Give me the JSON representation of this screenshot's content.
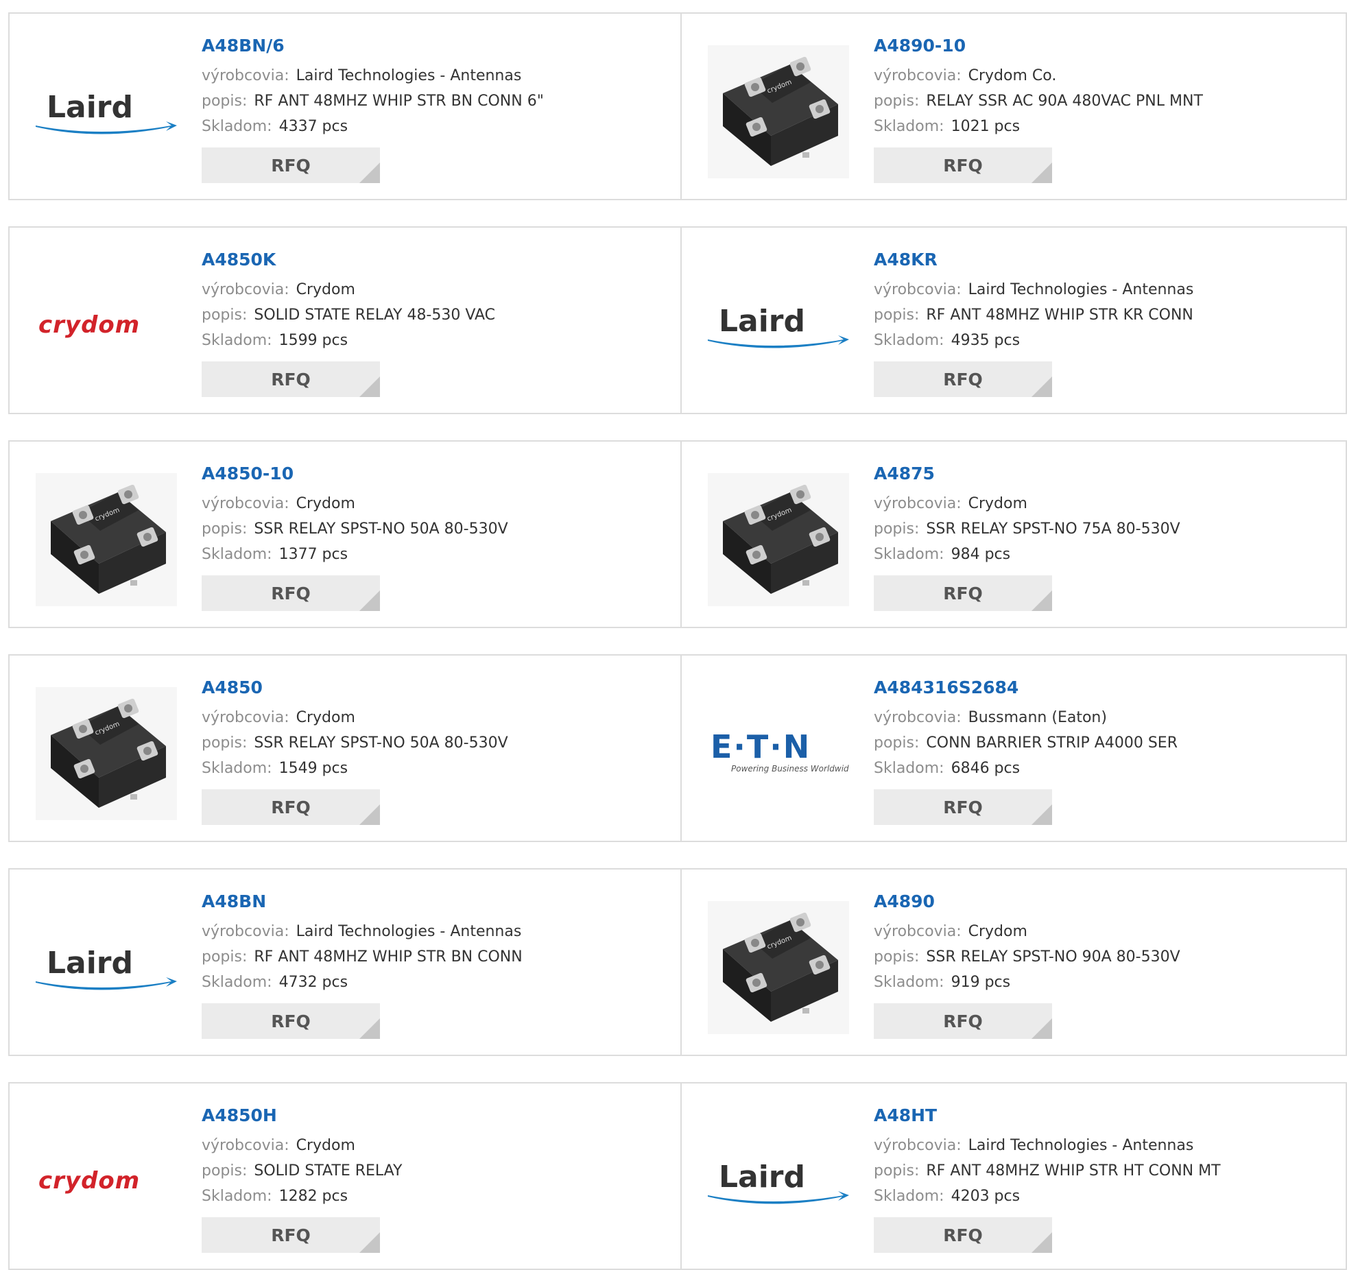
{
  "labels": {
    "manufacturer": "výrobcovia:",
    "description": "popis:",
    "stock": "Skladom:",
    "rfq": "RFQ"
  },
  "logos": {
    "laird": "Laird",
    "crydom": "crydom",
    "eaton": "E·T·N",
    "eaton_tagline": "Powering Business Worldwide",
    "relay_text": "crydom"
  },
  "colors": {
    "link": "#1a66b3",
    "laird_blue": "#1b7fc4",
    "crydom_red": "#d2232a",
    "eaton_blue": "#1b5fa8",
    "button_bg": "#ebebeb"
  },
  "products": [
    {
      "pn": "A48BN/6",
      "manufacturer": "Laird Technologies - Antennas",
      "description": "RF ANT 48MHZ WHIP STR BN CONN 6\"",
      "stock": "4337 pcs",
      "image": "laird-logo"
    },
    {
      "pn": "A4890-10",
      "manufacturer": "Crydom Co.",
      "description": "RELAY SSR AC 90A 480VAC PNL MNT",
      "stock": "1021 pcs",
      "image": "relay-photo"
    },
    {
      "pn": "A4850K",
      "manufacturer": "Crydom",
      "description": "SOLID STATE RELAY 48-530 VAC",
      "stock": "1599 pcs",
      "image": "crydom-logo"
    },
    {
      "pn": "A48KR",
      "manufacturer": "Laird Technologies - Antennas",
      "description": "RF ANT 48MHZ WHIP STR KR CONN",
      "stock": "4935 pcs",
      "image": "laird-logo"
    },
    {
      "pn": "A4850-10",
      "manufacturer": "Crydom",
      "description": "SSR RELAY SPST-NO 50A 80-530V",
      "stock": "1377 pcs",
      "image": "relay-photo"
    },
    {
      "pn": "A4875",
      "manufacturer": "Crydom",
      "description": "SSR RELAY SPST-NO 75A 80-530V",
      "stock": "984 pcs",
      "image": "relay-photo"
    },
    {
      "pn": "A4850",
      "manufacturer": "Crydom",
      "description": "SSR RELAY SPST-NO 50A 80-530V",
      "stock": "1549 pcs",
      "image": "relay-photo"
    },
    {
      "pn": "A484316S2684",
      "manufacturer": "Bussmann (Eaton)",
      "description": "CONN BARRIER STRIP A4000 SER",
      "stock": "6846 pcs",
      "image": "eaton-logo"
    },
    {
      "pn": "A48BN",
      "manufacturer": "Laird Technologies - Antennas",
      "description": "RF ANT 48MHZ WHIP STR BN CONN",
      "stock": "4732 pcs",
      "image": "laird-logo"
    },
    {
      "pn": "A4890",
      "manufacturer": "Crydom",
      "description": "SSR RELAY SPST-NO 90A 80-530V",
      "stock": "919 pcs",
      "image": "relay-photo"
    },
    {
      "pn": "A4850H",
      "manufacturer": "Crydom",
      "description": "SOLID STATE RELAY",
      "stock": "1282 pcs",
      "image": "crydom-logo"
    },
    {
      "pn": "A48HT",
      "manufacturer": "Laird Technologies - Antennas",
      "description": "RF ANT 48MHZ WHIP STR HT CONN MT",
      "stock": "4203 pcs",
      "image": "laird-logo"
    }
  ]
}
